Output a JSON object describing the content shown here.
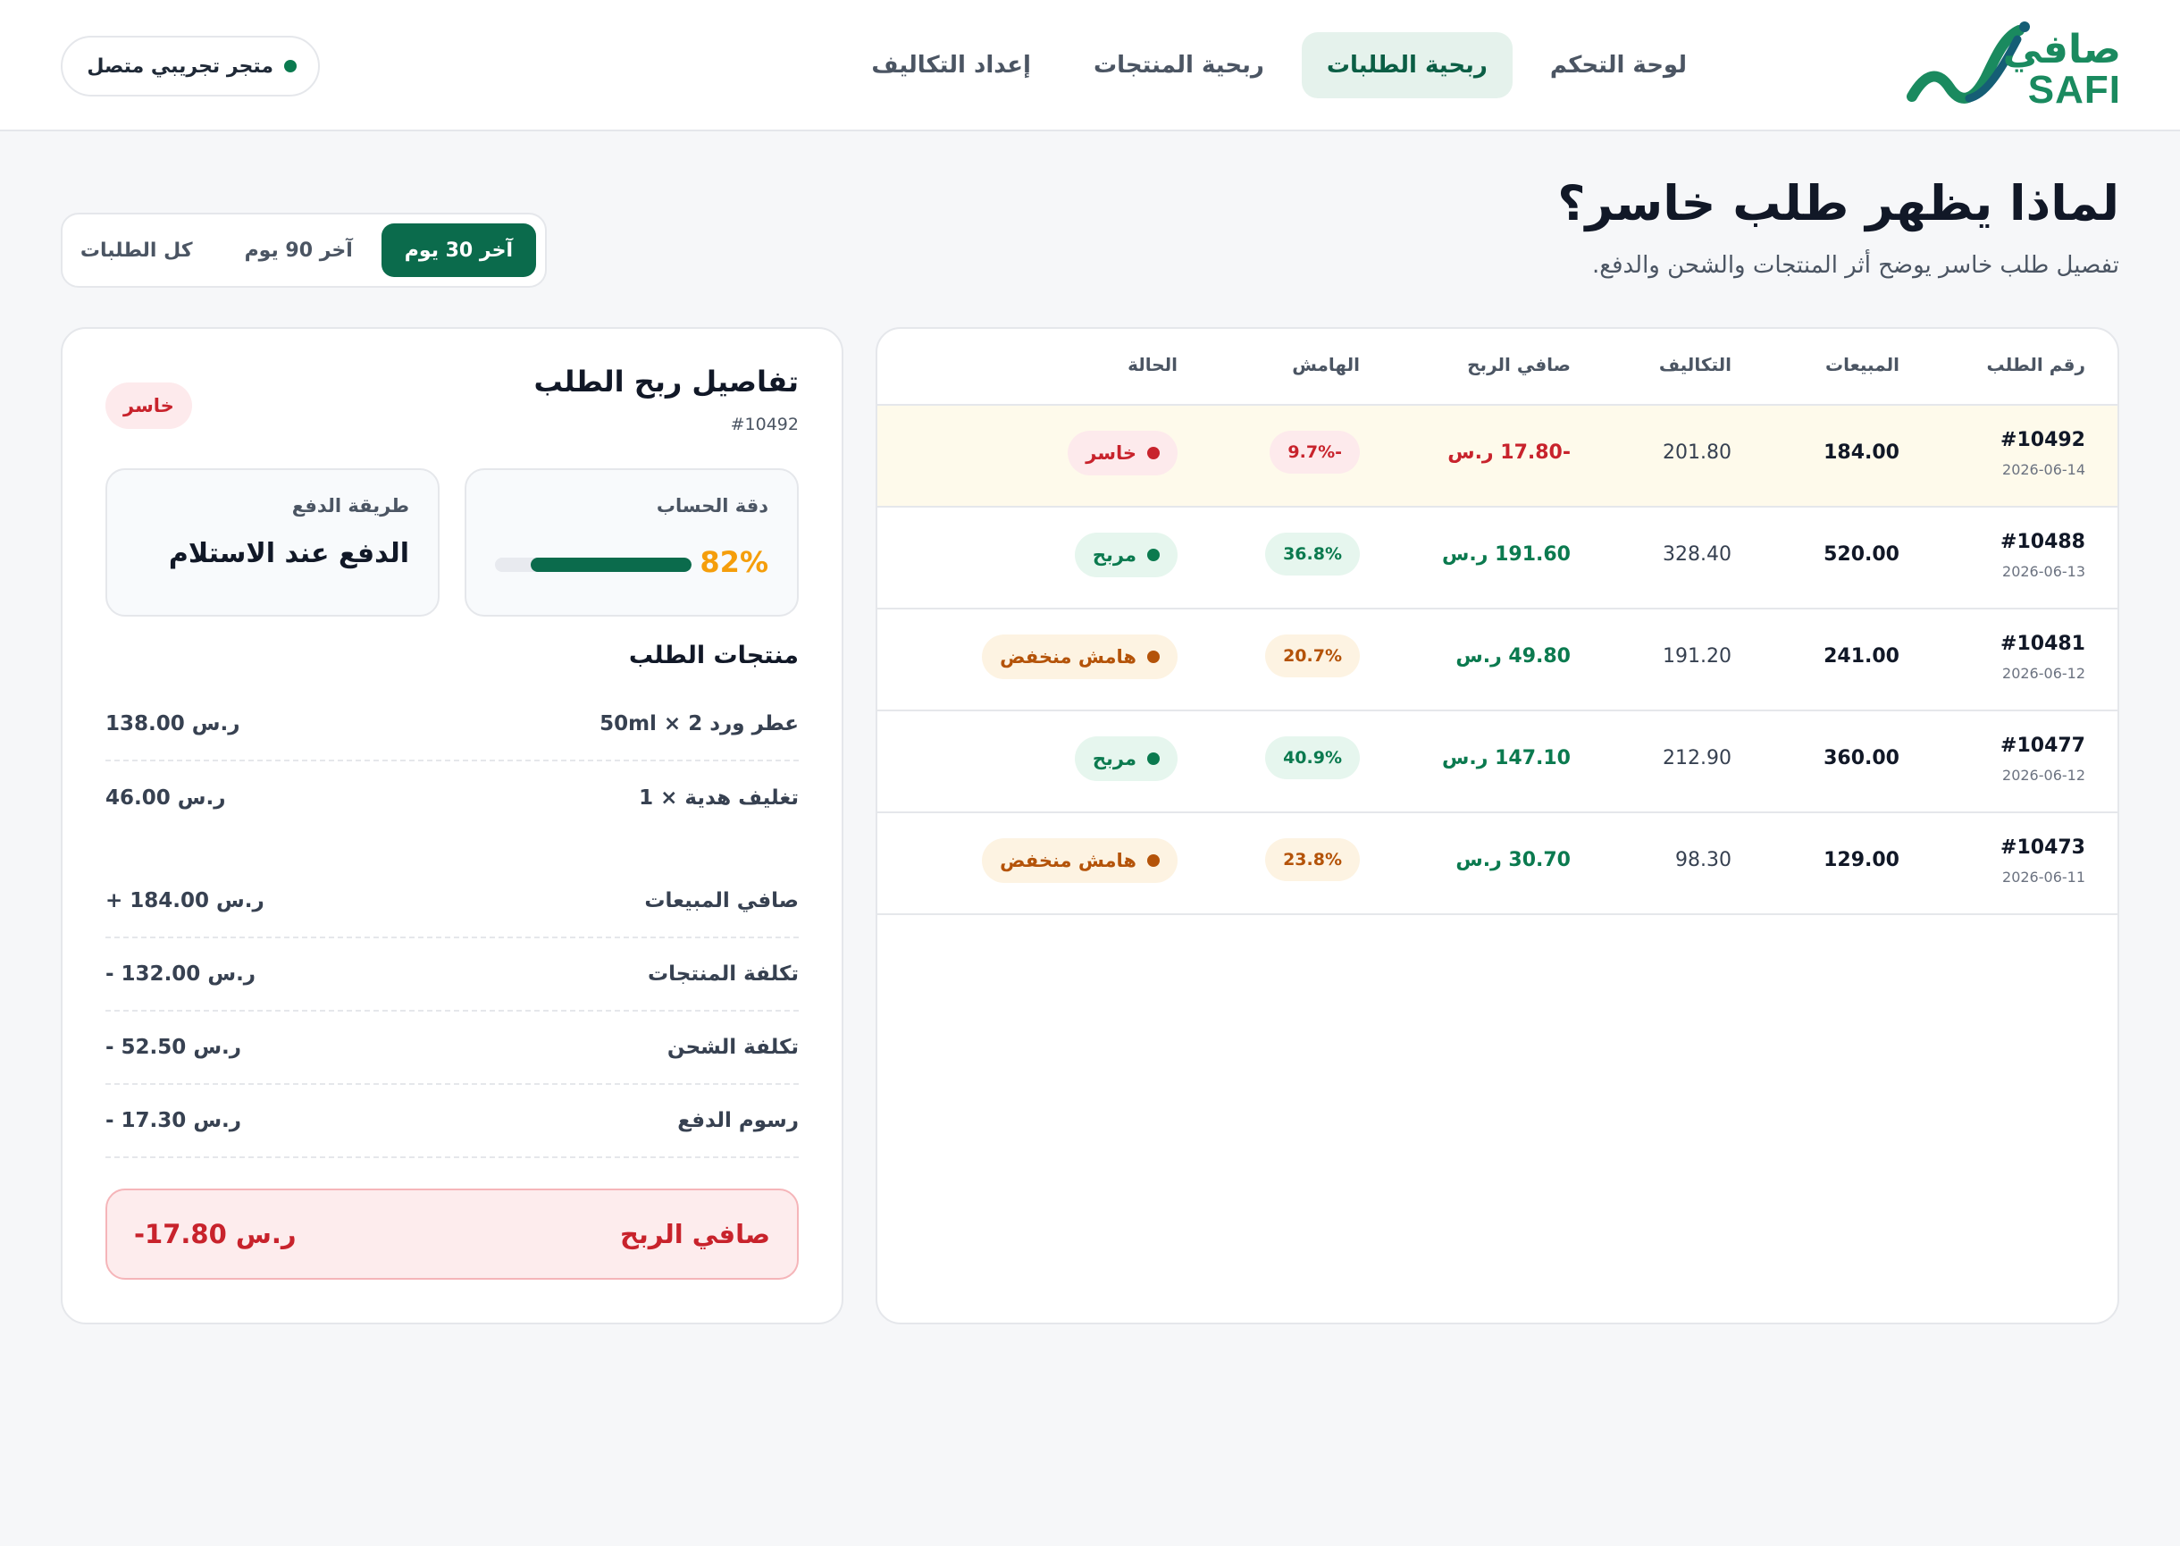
{
  "brand": {
    "ar": "صافي",
    "en": "SAFI"
  },
  "nav": {
    "items": [
      "لوحة التحكم",
      "ربحية الطلبات",
      "ربحية المنتجات",
      "إعداد التكاليف"
    ],
    "active": "ربحية الطلبات"
  },
  "store": {
    "label": "متجر تجريبي متصل"
  },
  "page": {
    "title": "لماذا يظهر طلب خاسر؟",
    "subtitle": "تفصيل طلب خاسر يوضح أثر المنتجات والشحن والدفع."
  },
  "range": {
    "options": [
      "آخر 30 يوم",
      "آخر 90 يوم",
      "كل الطلبات"
    ],
    "selected": "آخر 30 يوم"
  },
  "table": {
    "headers": {
      "order": "رقم الطلب",
      "sales": "المبيعات",
      "costs": "التكاليف",
      "profit": "صافي الربح",
      "margin": "الهامش",
      "status": "الحالة"
    },
    "rows": [
      {
        "id": "#10492",
        "date": "2026-06-14",
        "sales": "184.00",
        "costs": "201.80",
        "profit": "-17.80 ر.س",
        "margin": "-9.7%",
        "status": "خاسر",
        "tone": "loss",
        "highlighted": true
      },
      {
        "id": "#10488",
        "date": "2026-06-13",
        "sales": "520.00",
        "costs": "328.40",
        "profit": "191.60 ر.س",
        "margin": "36.8%",
        "status": "مربح",
        "tone": "win",
        "highlighted": false
      },
      {
        "id": "#10481",
        "date": "2026-06-12",
        "sales": "241.00",
        "costs": "191.20",
        "profit": "49.80 ر.س",
        "margin": "20.7%",
        "status": "هامش منخفض",
        "tone": "low",
        "highlighted": false
      },
      {
        "id": "#10477",
        "date": "2026-06-12",
        "sales": "360.00",
        "costs": "212.90",
        "profit": "147.10 ر.س",
        "margin": "40.9%",
        "status": "مربح",
        "tone": "win",
        "highlighted": false
      },
      {
        "id": "#10473",
        "date": "2026-06-11",
        "sales": "129.00",
        "costs": "98.30",
        "profit": "30.70 ر.س",
        "margin": "23.8%",
        "status": "هامش منخفض",
        "tone": "low",
        "highlighted": false
      }
    ]
  },
  "detail": {
    "title": "تفاصيل ربح الطلب",
    "order_id": "#10492",
    "badge": "خاسر",
    "accuracy": {
      "label": "دقة الحساب",
      "value": "82%",
      "fraction": 0.82
    },
    "payment": {
      "label": "طريقة الدفع",
      "value": "الدفع عند الاستلام"
    },
    "products_heading": "منتجات الطلب",
    "products": [
      {
        "name": "عطر ورد 50ml × 2",
        "value": "138.00 ر.س"
      },
      {
        "name": "تغليف هدية × 1",
        "value": "46.00 ر.س"
      }
    ],
    "breakdown": [
      {
        "name": "صافي المبيعات",
        "value": "+ 184.00 ر.س",
        "tone": "pos"
      },
      {
        "name": "تكلفة المنتجات",
        "value": "- 132.00 ر.س",
        "tone": "neg"
      },
      {
        "name": "تكلفة الشحن",
        "value": "- 52.50 ر.س",
        "tone": "neg"
      },
      {
        "name": "رسوم الدفع",
        "value": "- 17.30 ر.س",
        "tone": "neg"
      }
    ],
    "net": {
      "label": "صافي الربح",
      "value": "-17.80 ر.س"
    }
  },
  "colors": {
    "brand": "#1a8a5f",
    "primary": "#0b6b4c",
    "loss": "#c8232c",
    "profit": "#0b7a4f",
    "warning": "#b45309",
    "accuracy": "#f59e0b",
    "highlight_row": "#fefaeb"
  }
}
